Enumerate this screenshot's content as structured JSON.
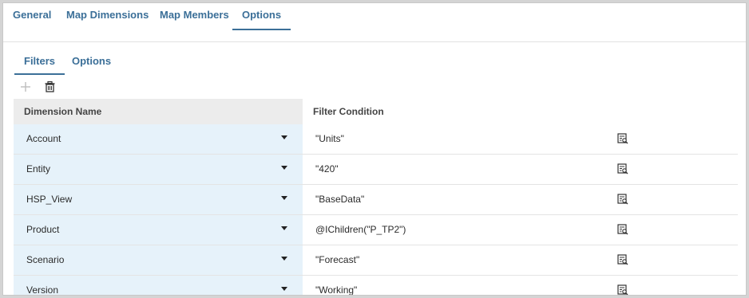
{
  "top_tabs": [
    {
      "label": "General"
    },
    {
      "label": "Map Dimensions"
    },
    {
      "label": "Map Members"
    },
    {
      "label": "Options"
    }
  ],
  "sub_tabs": [
    {
      "label": "Filters"
    },
    {
      "label": "Options"
    }
  ],
  "toolbar": {
    "add_icon": "plus-icon",
    "delete_icon": "delete-icon"
  },
  "grid": {
    "headers": [
      "Dimension Name",
      "Filter Condition"
    ],
    "rows": [
      {
        "dimension": "Account",
        "condition": "\"Units\""
      },
      {
        "dimension": "Entity",
        "condition": "\"420\""
      },
      {
        "dimension": "HSP_View",
        "condition": "\"BaseData\""
      },
      {
        "dimension": "Product",
        "condition": "@IChildren(\"P_TP2\")"
      },
      {
        "dimension": "Scenario",
        "condition": "\"Forecast\""
      },
      {
        "dimension": "Version",
        "condition": "\"Working\""
      }
    ]
  },
  "colors": {
    "accent": "#3b6f98",
    "selected_cell": "#e6f2fa"
  }
}
